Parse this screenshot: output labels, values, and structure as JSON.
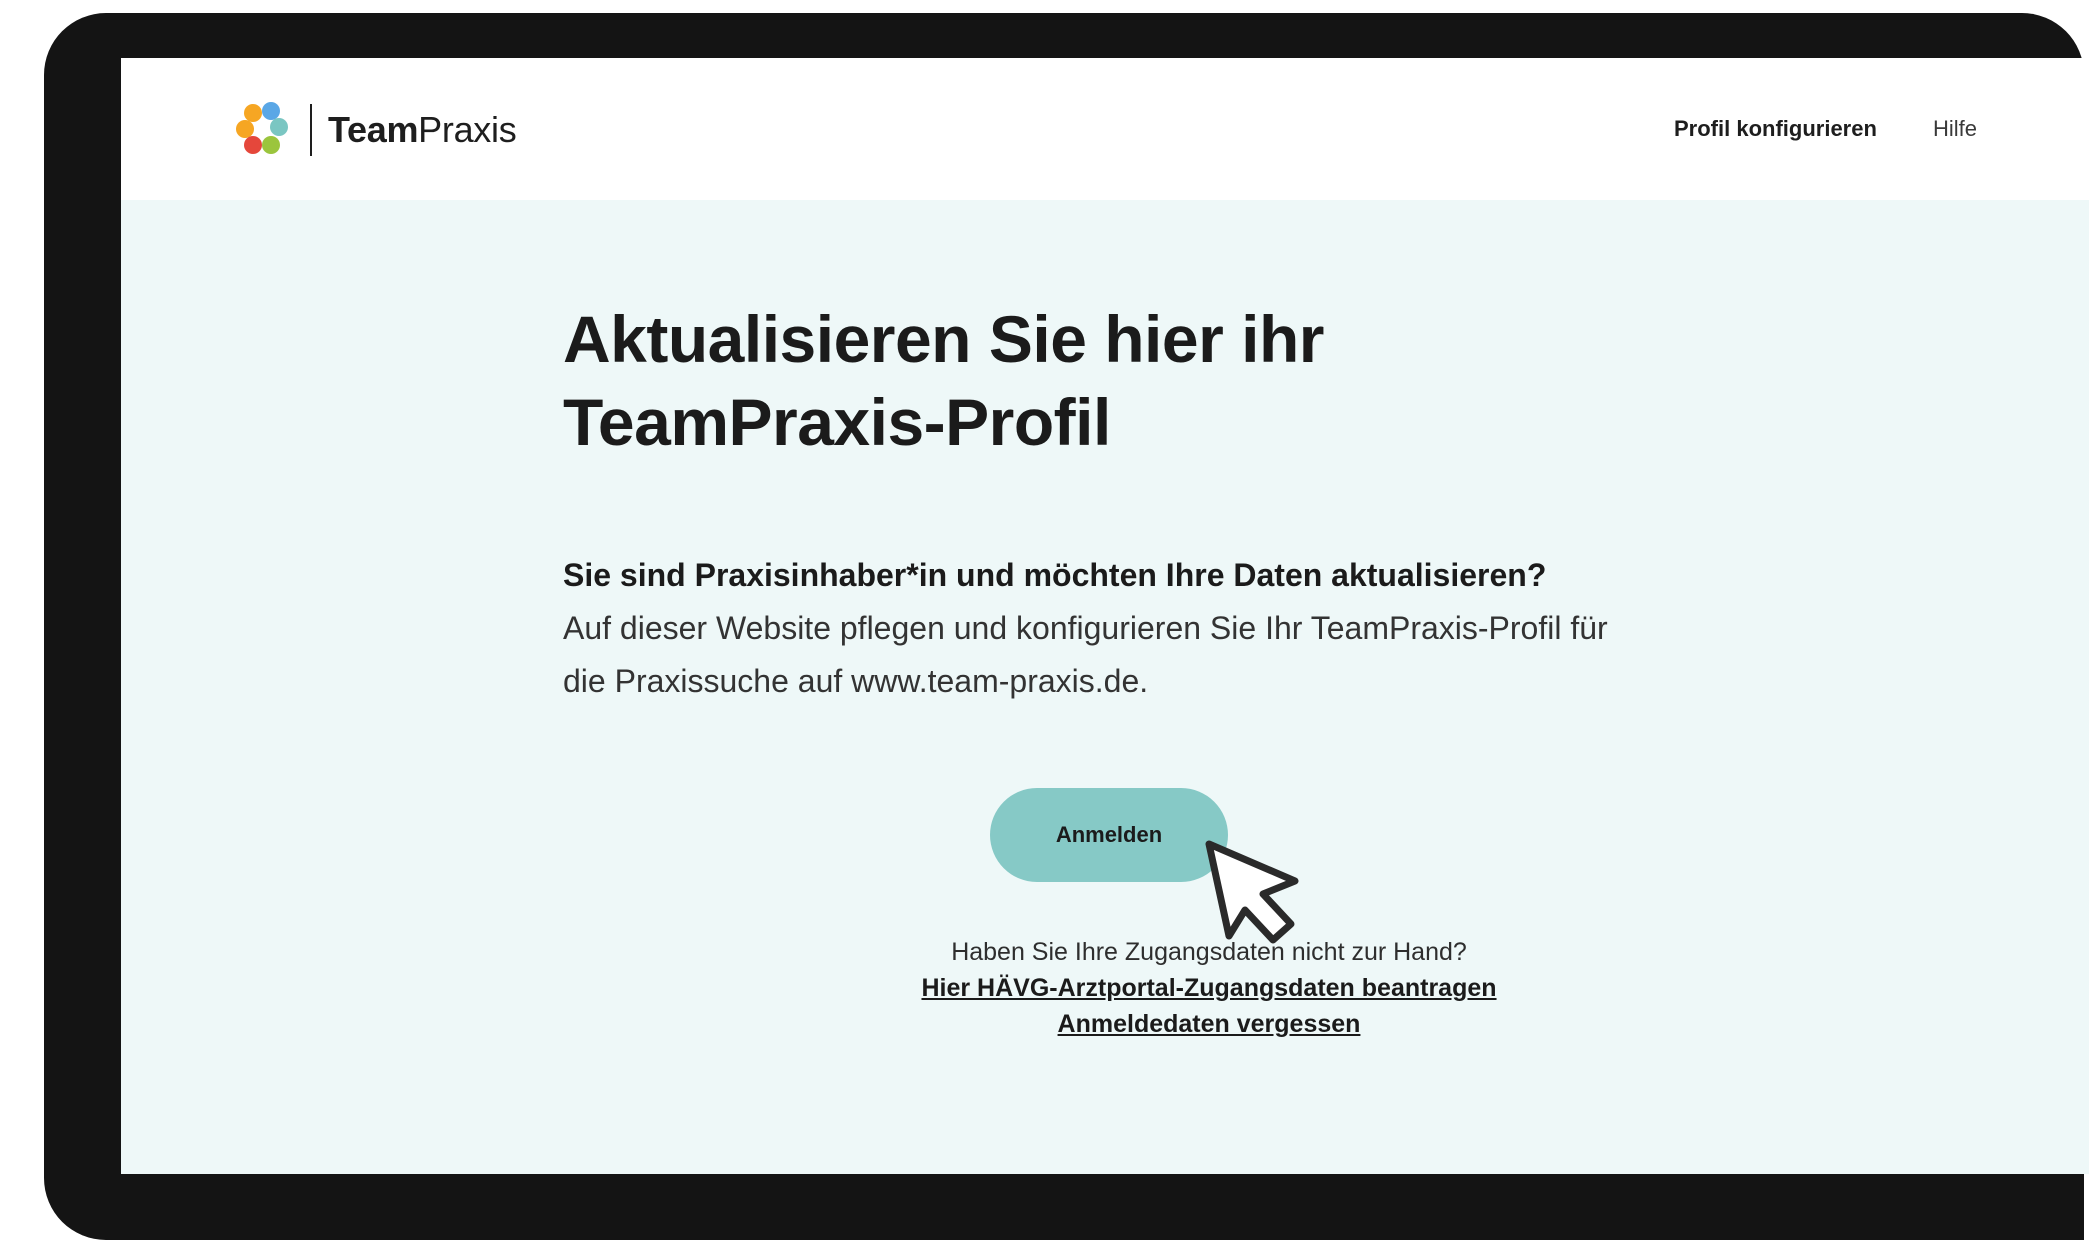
{
  "brand": {
    "name_bold": "Team",
    "name_regular": "Praxis",
    "dot_colors": [
      "#f6a623",
      "#5aa7e6",
      "#7ac6c2",
      "#e5473b",
      "#9bc53d"
    ]
  },
  "nav": {
    "profile_label": "Profil konfigurieren",
    "help_label": "Hilfe"
  },
  "main": {
    "headline_line1": "Aktualisieren Sie hier ihr",
    "headline_line2": "TeamPraxis-Profil",
    "lead": "Sie sind Praxisinhaber*in und möchten Ihre Daten aktualisieren?",
    "body": "Auf dieser Website pflegen und konfigurieren Sie Ihr TeamPraxis-Profil für die Praxissuche auf www.team-praxis.de.",
    "login_label": "Anmelden",
    "no_credentials_text": "Haben Sie Ihre Zugangsdaten nicht zur Hand?",
    "request_link": "Hier HÄVG-Arztportal-Zugangsdaten beantragen",
    "forgot_link": "Anmeldedaten vergessen"
  },
  "colors": {
    "device_frame": "#141414",
    "page_background": "#eef8f8",
    "button_accent": "#86c9c6"
  },
  "icons": [
    "teampraxis-logo-icon",
    "mouse-pointer-icon"
  ]
}
